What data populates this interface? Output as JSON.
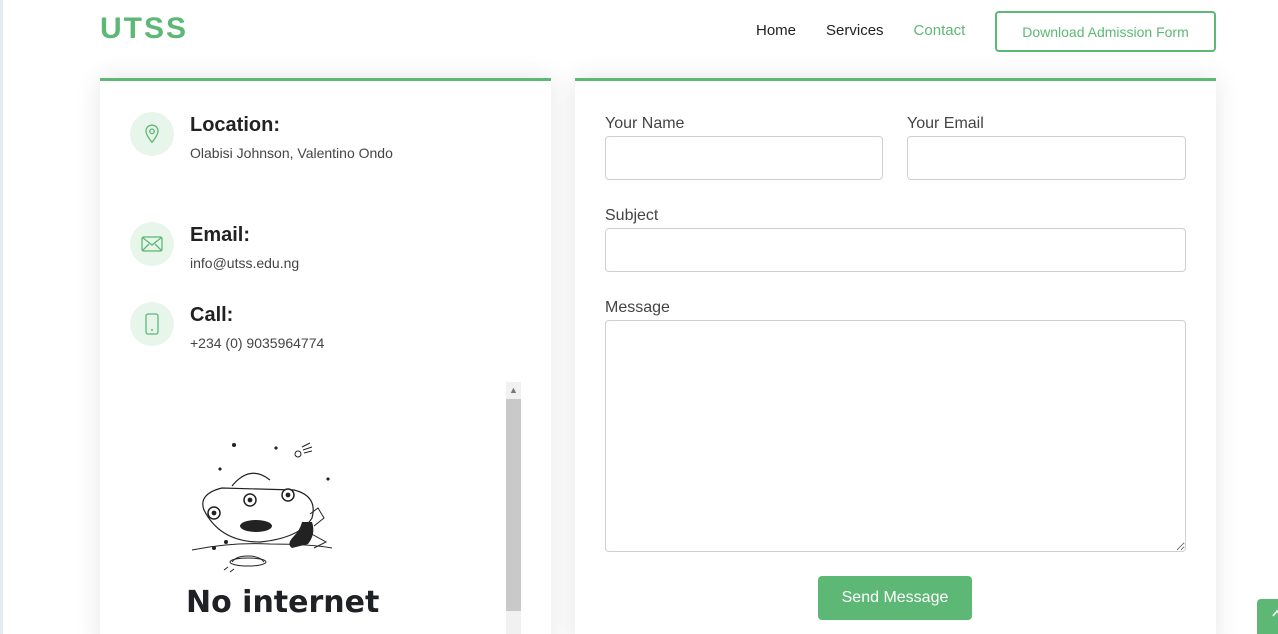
{
  "header": {
    "logo": "UTSS",
    "nav": [
      {
        "label": "Home",
        "active": false
      },
      {
        "label": "Services",
        "active": false
      },
      {
        "label": "Contact",
        "active": true
      }
    ],
    "download_label": "Download Admission Form"
  },
  "info": {
    "location": {
      "title": "Location:",
      "text": "Olabisi Johnson, Valentino Ondo",
      "icon": "map-pin-icon"
    },
    "email": {
      "title": "Email:",
      "text": "info@utss.edu.ng",
      "icon": "envelope-icon"
    },
    "call": {
      "title": "Call:",
      "text": "+234 (0) 9035964774",
      "icon": "phone-icon"
    }
  },
  "map_frame": {
    "error_title": "No internet",
    "illustration": "dino-ufo-icon"
  },
  "form": {
    "name_label": "Your Name",
    "name_value": "",
    "email_label": "Your Email",
    "email_value": "",
    "subject_label": "Subject",
    "subject_value": "",
    "message_label": "Message",
    "message_value": "",
    "submit_label": "Send Message"
  },
  "colors": {
    "accent": "#5cb874",
    "icon_bg": "#e7f5ea",
    "text": "#222222"
  }
}
